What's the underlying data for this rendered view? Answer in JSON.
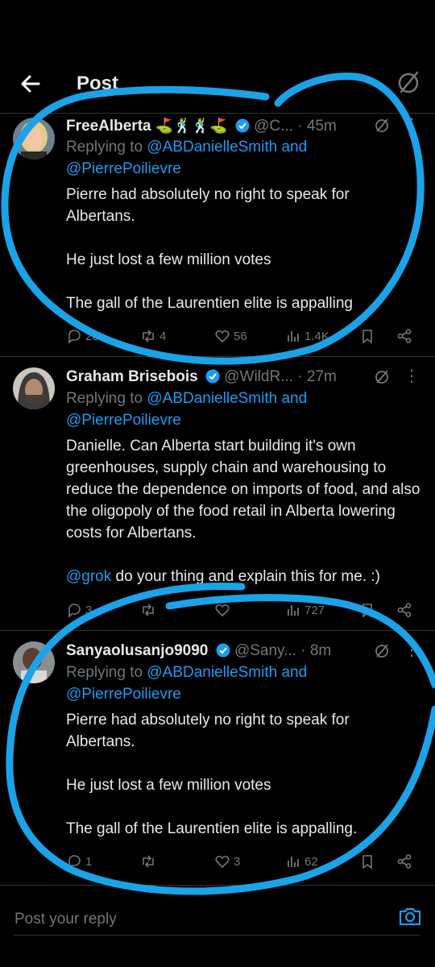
{
  "header": {
    "title": "Post"
  },
  "tweets": [
    {
      "name": "FreeAlberta",
      "emojis": "⛳🕺🕺⛳",
      "handle": "@C...",
      "dot": "·",
      "time": "45m",
      "replying_prefix": "Replying to ",
      "reply_mention_1": "@ABDanielleSmith",
      "reply_and": " and",
      "reply_mention_2": "@PierrePoilievre",
      "text_1": "Pierre had absolutely no right to speak for Albertans.",
      "text_2": "He just lost a few million votes",
      "text_3": "The gall of the Laurentien elite is appalling",
      "stats": {
        "replies": "28",
        "reposts": "4",
        "likes": "56",
        "views": "1.4K"
      }
    },
    {
      "name": "Graham Brisebois",
      "emojis": "",
      "handle": "@WildR...",
      "dot": "·",
      "time": "27m",
      "replying_prefix": "Replying to ",
      "reply_mention_1": "@ABDanielleSmith",
      "reply_and": " and",
      "reply_mention_2": "@PierrePoilievre",
      "text_1": "Danielle. Can Alberta start building it's own greenhouses, supply chain and warehousing to reduce the dependence on imports of food, and also the oligopoly of the food retail in Alberta lowering costs for Albertans.",
      "text_2_mention": "@grok",
      "text_2": " do your thing and explain this for me. :)",
      "stats": {
        "replies": "3",
        "reposts": "",
        "likes": "",
        "views": "727"
      }
    },
    {
      "name": "Sanyaolusanjo9090",
      "emojis": "",
      "handle": "@Sany...",
      "dot": "·",
      "time": "8m",
      "replying_prefix": "Replying to ",
      "reply_mention_1": "@ABDanielleSmith",
      "reply_and": " and",
      "reply_mention_2": "@PierrePoilievre",
      "text_1": "Pierre had absolutely no right to speak for Albertans.",
      "text_2": "He just lost a few million votes",
      "text_3": "The gall of the Laurentien elite is appalling.",
      "stats": {
        "replies": "1",
        "reposts": "",
        "likes": "3",
        "views": "62"
      }
    }
  ],
  "reply": {
    "placeholder": "Post your reply"
  },
  "colors": {
    "accent": "#1d9bf0",
    "annotation": "#1aa3e8",
    "muted": "#71767b"
  },
  "icons": [
    "back-arrow-icon",
    "grok-icon",
    "verified-badge-icon",
    "more-icon",
    "reply-icon",
    "repost-icon",
    "like-icon",
    "views-icon",
    "bookmark-icon",
    "share-icon",
    "camera-icon"
  ]
}
